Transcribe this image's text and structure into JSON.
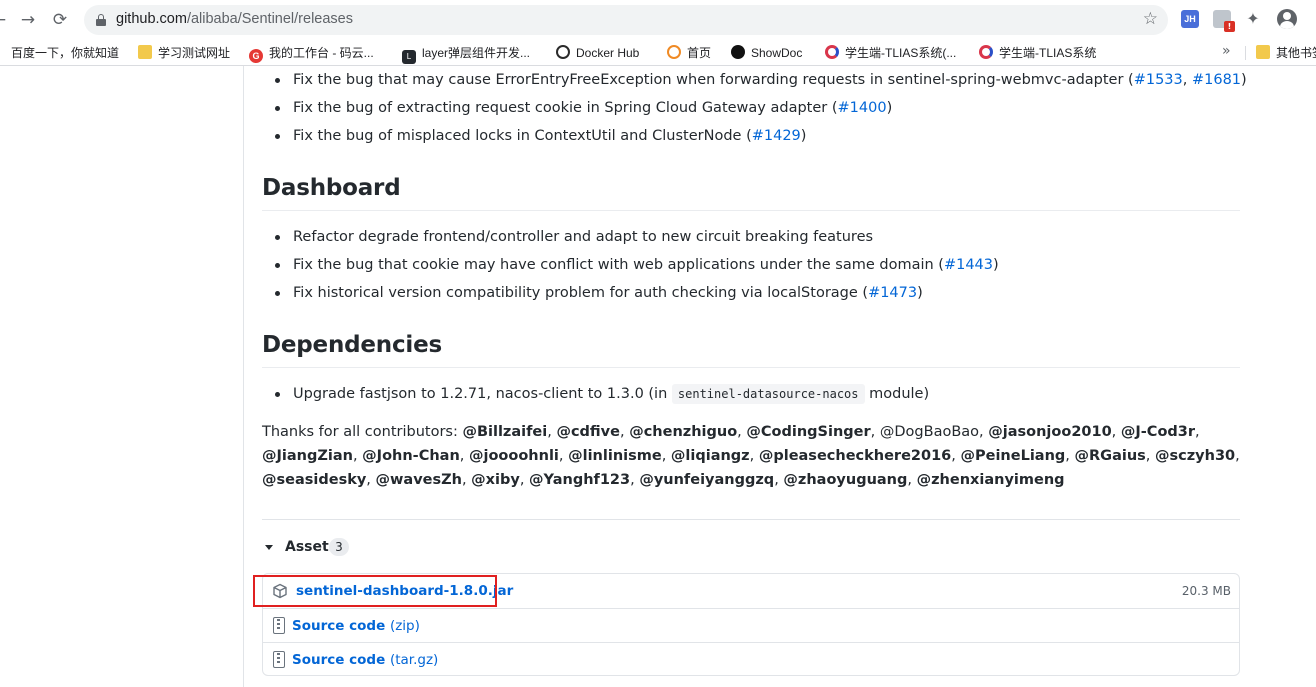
{
  "browser": {
    "url_host": "github.com",
    "url_path": "/alibaba/Sentinel/releases",
    "extensions": {
      "jh_label": "JH",
      "warn_label": "!"
    },
    "bookmarks": [
      {
        "label": "百度一下，你就知道",
        "icon": "folder-icon"
      },
      {
        "label": "学习测试网址",
        "icon": "folder-icon"
      },
      {
        "label": "我的工作台 - 码云...",
        "icon": "gitee-icon"
      },
      {
        "label": "layer弹层组件开发...",
        "icon": "layer-icon"
      },
      {
        "label": "Docker Hub",
        "icon": "docker-icon"
      },
      {
        "label": "首页",
        "icon": "home-icon"
      },
      {
        "label": "ShowDoc",
        "icon": "showdoc-icon"
      },
      {
        "label": "学生端-TLIAS系统(...",
        "icon": "tlias-icon"
      },
      {
        "label": "学生端-TLIAS系统",
        "icon": "tlias-icon"
      }
    ],
    "more_label": "»",
    "other_bookmarks": "其他书签"
  },
  "fixes_top": [
    {
      "text": "Fix the bug that may cause ErrorEntryFreeException when forwarding requests in sentinel-spring-webmvc-adapter (",
      "links": [
        "#1533",
        "#1681"
      ],
      "tail": ")"
    },
    {
      "text": "Fix the bug of extracting request cookie in Spring Cloud Gateway adapter (",
      "links": [
        "#1400"
      ],
      "tail": ")"
    },
    {
      "text": "Fix the bug of misplaced locks in ContextUtil and ClusterNode (",
      "links": [
        "#1429"
      ],
      "tail": ")"
    }
  ],
  "dashboard": {
    "heading": "Dashboard",
    "items": [
      {
        "text": "Refactor degrade frontend/controller and adapt to new circuit breaking features",
        "links": [],
        "tail": ""
      },
      {
        "text": "Fix the bug that cookie may have conflict with web applications under the same domain (",
        "links": [
          "#1443"
        ],
        "tail": ")"
      },
      {
        "text": "Fix historical version compatibility problem for auth checking via localStorage (",
        "links": [
          "#1473"
        ],
        "tail": ")"
      }
    ]
  },
  "dependencies": {
    "heading": "Dependencies",
    "item_pre": "Upgrade fastjson to 1.2.71, nacos-client to 1.3.0 (in",
    "item_code": "sentinel-datasource-nacos",
    "item_post": "module)"
  },
  "thanks": {
    "prefix": "Thanks for all contributors:",
    "contributors": [
      "@Billzaifei",
      "@cdfive",
      "@chenzhiguo",
      "@CodingSinger",
      "@DogBaoBao",
      "@jasonjoo2010",
      "@J-Cod3r",
      "@JiangZian",
      "@John-Chan",
      "@joooohnli",
      "@linlinisme",
      "@liqiangz",
      "@pleasecheckhere2016",
      "@PeineLiang",
      "@RGaius",
      "@sczyh30",
      "@seasidesky",
      "@wavesZh",
      "@xiby",
      "@Yanghf123",
      "@yunfeiyanggzq",
      "@zhaoyuguang",
      "@zhenxianyimeng"
    ]
  },
  "assets": {
    "label": "Assets",
    "count": "3",
    "items": [
      {
        "name": "sentinel-dashboard-1.8.0.jar",
        "note": "",
        "size": "20.3 MB",
        "icon": "package-icon"
      },
      {
        "name": "Source code",
        "note": "(zip)",
        "size": "",
        "icon": "file-zip-icon"
      },
      {
        "name": "Source code",
        "note": "(tar.gz)",
        "size": "",
        "icon": "file-zip-icon"
      }
    ]
  }
}
